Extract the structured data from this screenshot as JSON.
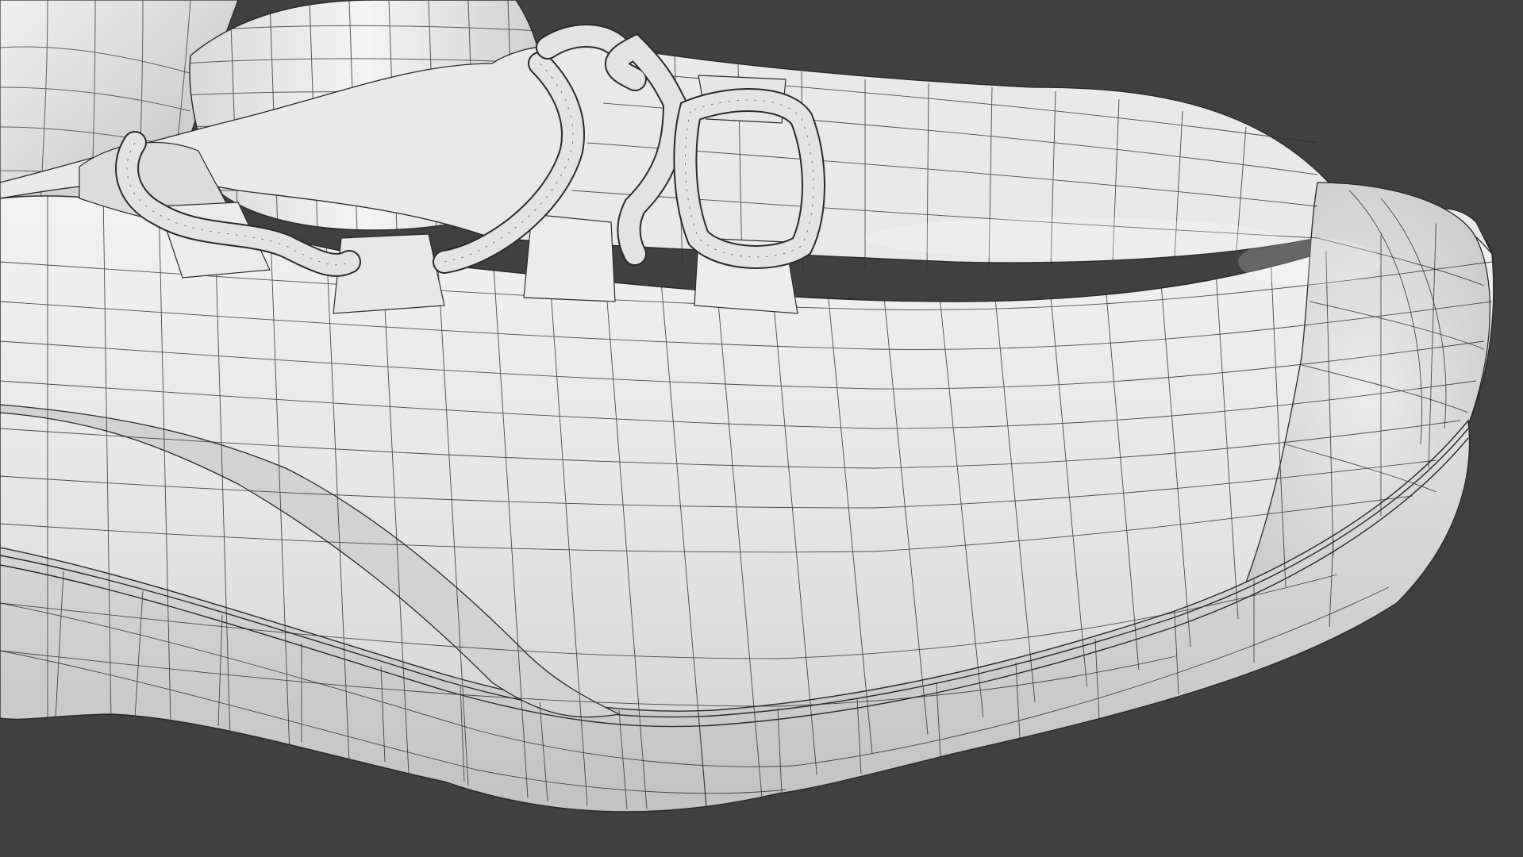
{
  "viewport": {
    "background_color": "#404040",
    "mesh_base_color": "#e6e6e6",
    "mesh_shadow_color": "#a9a9a9",
    "wire_color": "#2a2a2a"
  },
  "subject": {
    "icon": "shoe-mesh-icon",
    "parts": [
      "shoe-upper",
      "shoe-toe-cap",
      "shoe-sole",
      "shoe-tongue",
      "shoe-collar",
      "lace-loops",
      "eyelet-tabs",
      "quarter-seam"
    ]
  }
}
